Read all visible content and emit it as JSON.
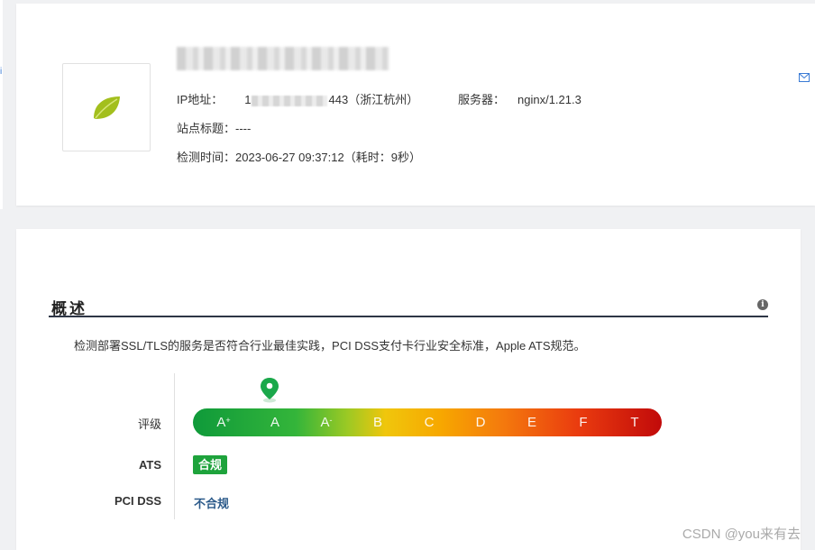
{
  "site": {
    "ip_label": "IP地址：",
    "ip_prefix": "1",
    "ip_suffix": "443（浙江杭州）",
    "server_label": "服务器：",
    "server_value": "nginx/1.21.3",
    "title_label": "站点标题：",
    "title_value": "----",
    "check_time_label": "检测时间：",
    "check_time_value": "2023-06-27 09:37:12（耗时：9秒）"
  },
  "overview": {
    "title": "概述",
    "description": "检测部署SSL/TLS的服务是否符合行业最佳实践，PCI DSS支付卡行业安全标准，Apple ATS规范。",
    "rating_label": "评级",
    "grades": [
      {
        "letter": "A",
        "mod": "+"
      },
      {
        "letter": "A",
        "mod": ""
      },
      {
        "letter": "A",
        "mod": "-"
      },
      {
        "letter": "B",
        "mod": ""
      },
      {
        "letter": "C",
        "mod": ""
      },
      {
        "letter": "D",
        "mod": ""
      },
      {
        "letter": "E",
        "mod": ""
      },
      {
        "letter": "F",
        "mod": ""
      },
      {
        "letter": "T",
        "mod": ""
      }
    ],
    "current_grade_index": 1,
    "ats_label": "ATS",
    "ats_status": "合规",
    "pci_label": "PCI DSS",
    "pci_status": "不合规"
  },
  "colors": {
    "ats_badge": "#1ea33c",
    "pin": "#1aa84a",
    "pci_status": "#2b5a8a",
    "section_rule": "#2e3646"
  },
  "icons": [
    "leaf-logo-icon",
    "mail-icon",
    "info-icon",
    "location-pin-icon"
  ],
  "watermark": "CSDN @you来有去"
}
